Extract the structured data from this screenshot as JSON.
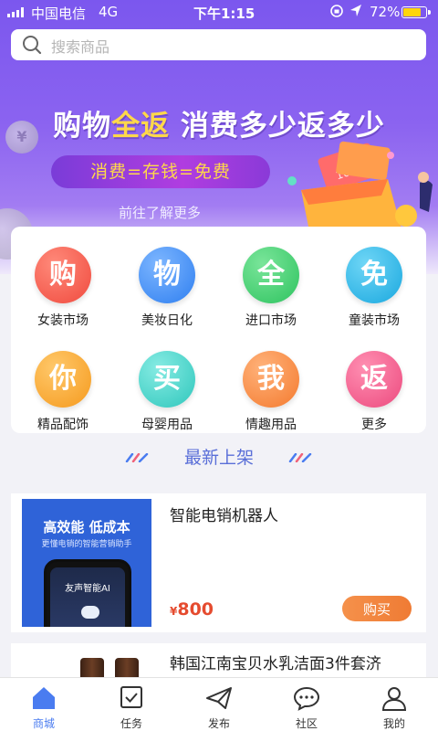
{
  "status": {
    "carrier": "中国电信",
    "network": "4G",
    "time": "下午1:15",
    "battery": "72%"
  },
  "search": {
    "placeholder": "搜索商品"
  },
  "banner": {
    "headline_a": "购物",
    "headline_b": "全返",
    "headline_c": "消费多少返多少",
    "slogan": "消费=存钱=免费",
    "link": "前往了解更多",
    "coin_glyph": "¥",
    "money_note": "100"
  },
  "categories": [
    {
      "char": "购",
      "label": "女装市场",
      "color": "#f25a4e"
    },
    {
      "char": "物",
      "label": "美妆日化",
      "color": "#3f8ef2"
    },
    {
      "char": "全",
      "label": "进口市场",
      "color": "#3fce6a"
    },
    {
      "char": "免",
      "label": "童装市场",
      "color": "#25b6e6"
    },
    {
      "char": "你",
      "label": "精品配饰",
      "color": "#f7a52e"
    },
    {
      "char": "买",
      "label": "母婴用品",
      "color": "#3fcfc6"
    },
    {
      "char": "我",
      "label": "情趣用品",
      "color": "#f58b3a"
    },
    {
      "char": "返",
      "label": "更多",
      "color": "#f05b8b"
    }
  ],
  "section": {
    "title": "最新上架"
  },
  "products": [
    {
      "name": "智能电销机器人",
      "currency": "¥",
      "price": "800",
      "buy": "购买",
      "img_title": "高效能  低成本",
      "img_sub": "更懂电销的智能营销助手",
      "img_screen": "友声智能AI"
    },
    {
      "name": "韩国江南宝贝水乳洁面3件套济"
    }
  ],
  "tabs": [
    {
      "label": "商城",
      "icon": "home-icon",
      "active": true
    },
    {
      "label": "任务",
      "icon": "checkbox-icon"
    },
    {
      "label": "发布",
      "icon": "send-icon"
    },
    {
      "label": "社区",
      "icon": "chat-icon"
    },
    {
      "label": "我的",
      "icon": "user-icon"
    }
  ],
  "colors": {
    "accent": "#4a7cf0",
    "price": "#e54b2f",
    "banner": "#7b57ee"
  }
}
